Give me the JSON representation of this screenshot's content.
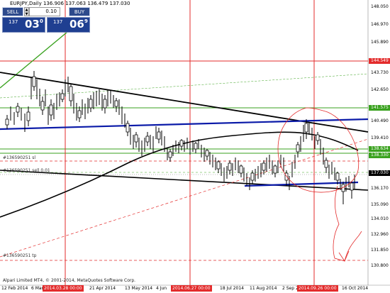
{
  "chart_header": {
    "title": "EURJPY,Daily  136.906 137.063 136.479 137.030"
  },
  "trade_panel": {
    "sell_label": "SELL",
    "buy_label": "BUY",
    "lot_value": "0.10",
    "spin_up": "▲",
    "spin_down": "▼",
    "bid_big": "137",
    "bid_pips": "03",
    "bid_point": "0",
    "ask_big": "137",
    "ask_pips": "06",
    "ask_point": "9"
  },
  "price_axis": {
    "labels": [
      "148.050",
      "146.970",
      "145.890",
      "144.549",
      "143.730",
      "142.650",
      "141.575",
      "140.490",
      "139.410",
      "138.634",
      "138.330",
      "137.030",
      "136.170",
      "135.090",
      "134.010",
      "132.960",
      "131.850",
      "130.800"
    ],
    "badges": [
      {
        "text": "144.549",
        "color": "#e32b2b"
      },
      {
        "text": "141.575",
        "color": "#3aa21f"
      },
      {
        "text": "138.634",
        "color": "#3aa21f"
      },
      {
        "text": "138.330",
        "color": "#3aa21f"
      },
      {
        "text": "137.030",
        "color": "#000000"
      }
    ]
  },
  "time_axis": {
    "labels": [
      "12 Feb 2014",
      "6 Mar",
      "2014.03.28 00:00",
      "21 Apr 2014",
      "13 May 2014",
      "4 Jun",
      "2014.06.27 00:00",
      "18 Jul 2014",
      "11 Aug 2014",
      "2 Sep 2",
      "2014.09.26 00:00",
      "16 Oct 2014"
    ],
    "highlighted": [
      "2014.03.28 00:00",
      "2014.06.27 00:00",
      "2014.09.26 00:00"
    ]
  },
  "order_lines": {
    "sl_label": "#136590251 sl",
    "sell_label": "#136590251 sell 0.01",
    "tp_label": "#136590251 tp"
  },
  "footer": {
    "copyright": "Alpari Limited MT4, © 2001-2014, MetaQuotes Software Corp."
  },
  "colors": {
    "red_line": "#e32b2b",
    "green_line": "#3aa21f",
    "blue_trend": "#0a1aa8",
    "black_trend": "#000000",
    "candle": "#000000"
  },
  "chart_data": {
    "type": "candlestick",
    "symbol": "EURJPY",
    "timeframe": "Daily",
    "ohlc_last": {
      "open": 136.906,
      "high": 137.063,
      "low": 136.479,
      "close": 137.03
    },
    "ylim": [
      130.8,
      148.05
    ],
    "horizontal_levels": [
      {
        "price": 144.549,
        "color": "red"
      },
      {
        "price": 141.575,
        "color": "green"
      },
      {
        "price": 138.634,
        "color": "green"
      },
      {
        "price": 138.33,
        "color": "green"
      },
      {
        "price": 137.03,
        "color": "black"
      }
    ],
    "vertical_markers": [
      "2014.03.28 00:00",
      "2014.06.27 00:00",
      "2014.09.26 00:00"
    ]
  }
}
